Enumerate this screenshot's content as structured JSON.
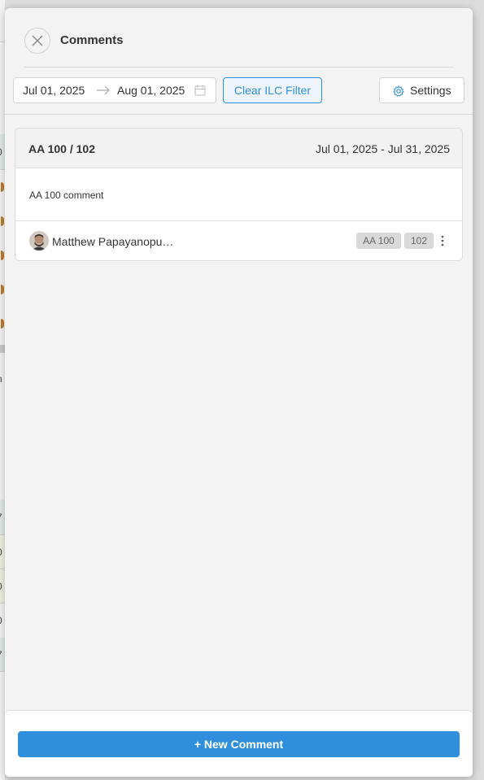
{
  "background": {
    "glyphs": [
      "0",
      "n",
      "7",
      "0",
      "0",
      "0",
      "7"
    ]
  },
  "panel": {
    "title": "Comments",
    "close_icon": "close-icon"
  },
  "toolbar": {
    "date_start": "Jul 01, 2025",
    "date_end": "Aug 01, 2025",
    "arrow_icon": "arrow-right-icon",
    "calendar_icon": "calendar-icon",
    "clear_filter_label": "Clear ILC Filter",
    "settings_label": "Settings",
    "settings_icon": "gear-icon"
  },
  "comment_card": {
    "title": "AA 100 / 102",
    "date_range": "Jul 01, 2025 - Jul 31, 2025",
    "text": "AA 100 comment",
    "author": "Matthew Papayanopu…",
    "tags": [
      "AA 100",
      "102"
    ],
    "menu_icon": "more-vertical-icon"
  },
  "footer": {
    "new_comment_label": "+ New Comment"
  },
  "colors": {
    "accent": "#2f8fdc",
    "panel_bg": "#f3f3f3",
    "tag_bg": "#d9d9d9"
  }
}
